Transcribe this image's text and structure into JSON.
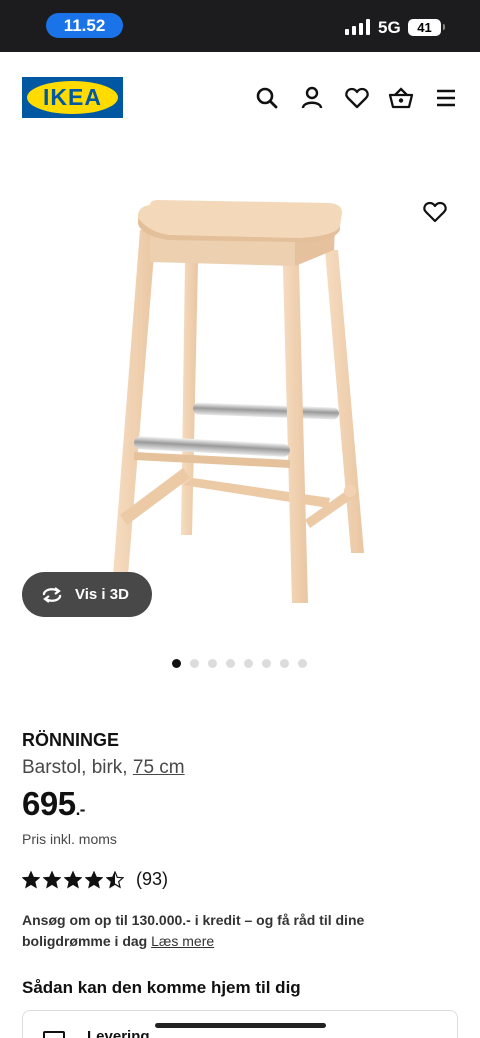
{
  "status_bar": {
    "time": "11.52",
    "network": "5G",
    "battery": "41"
  },
  "header": {
    "logo_text": "IKEA",
    "icons": [
      "search-icon",
      "account-icon",
      "heart-icon",
      "basket-icon",
      "menu-icon"
    ]
  },
  "gallery": {
    "view_3d_label": "Vis i 3D",
    "image_count": 8,
    "active_index": 0
  },
  "product": {
    "name": "RÖNNINGE",
    "description": "Barstol, birk,",
    "size": "75 cm",
    "price": "695",
    "price_suffix": ".-",
    "price_note": "Pris inkl. moms",
    "rating": 4.5,
    "review_count": "(93)"
  },
  "credit": {
    "text": "Ansøg om op til 130.000.- i kredit – og få råd til dine boligdrømme i dag",
    "link": "Læs mere"
  },
  "delivery": {
    "title": "Sådan kan den komme hjem til dig",
    "option": "Levering"
  },
  "colors": {
    "brand_blue": "#0058a3",
    "brand_yellow": "#ffdb00",
    "time_pill": "#1a73e8"
  }
}
